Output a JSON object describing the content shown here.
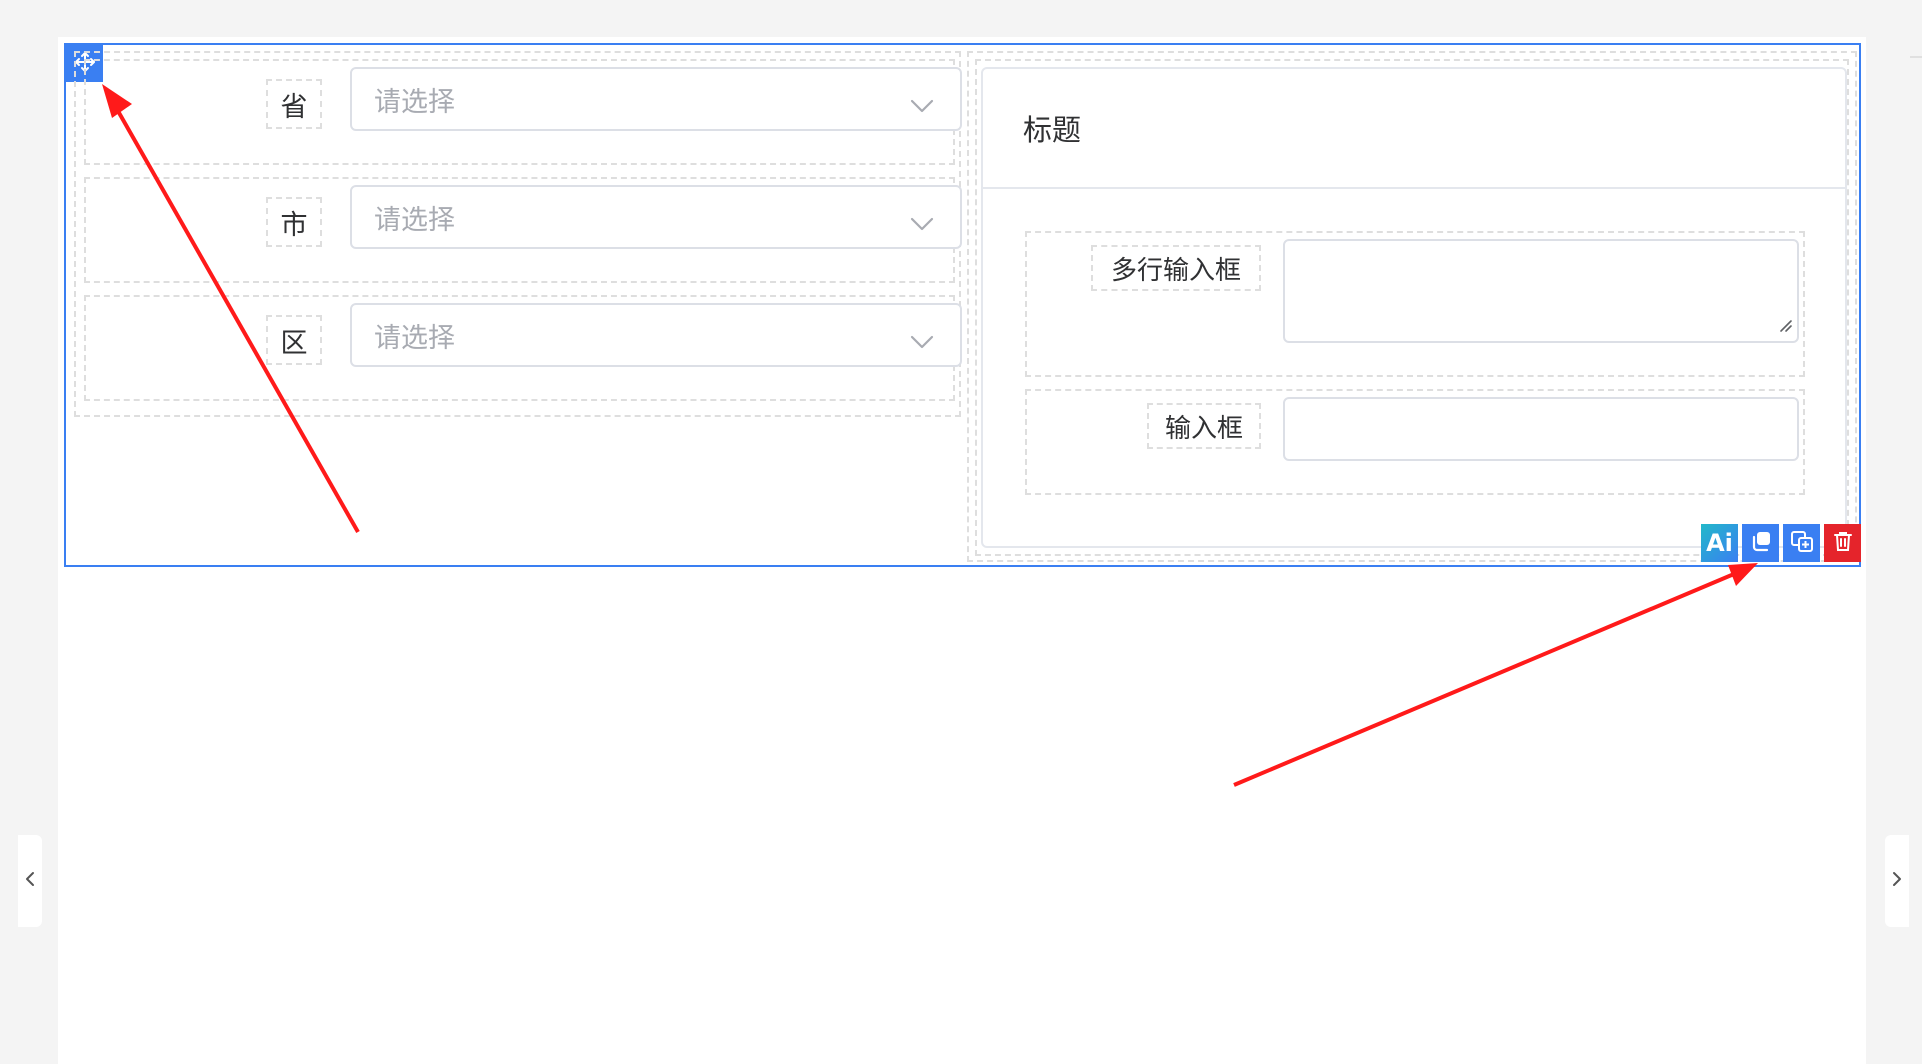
{
  "left_form": {
    "rows": [
      {
        "label": "省",
        "placeholder": "请选择"
      },
      {
        "label": "市",
        "placeholder": "请选择"
      },
      {
        "label": "区",
        "placeholder": "请选择"
      }
    ]
  },
  "card": {
    "title": "标题",
    "fields": [
      {
        "label": "多行输入框",
        "type": "textarea"
      },
      {
        "label": "输入框",
        "type": "input"
      }
    ]
  },
  "toolbar": {
    "ai_label": "Ai",
    "buttons": [
      "ai-icon",
      "copy-icon",
      "duplicate-icon",
      "delete-icon"
    ]
  },
  "icons": {
    "move": "move-icon",
    "chevron": "chevron-down-icon",
    "nav_left": "chevron-left-icon",
    "nav_right": "chevron-right-icon"
  },
  "colors": {
    "selection": "#3a7ff2",
    "ai_gradient_start": "#22b8c9",
    "ai_gradient_end": "#3a7ff2",
    "delete": "#e5242b",
    "annotation_arrow": "#ff1a1a"
  }
}
